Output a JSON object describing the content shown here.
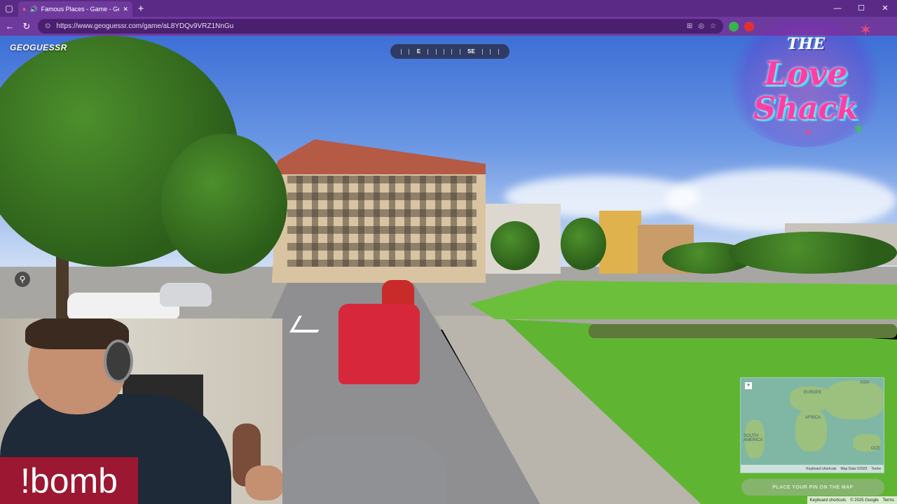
{
  "browser": {
    "tab_title": "Famous Places - Game - Geo",
    "url": "https://www.geoguessr.com/game/aL8YDQv9VRZ1NnGu",
    "window_controls": [
      "—",
      "☐",
      "✕"
    ]
  },
  "game": {
    "logo": "GEOGUESSR",
    "compass": {
      "labels": [
        "E",
        "SE"
      ]
    },
    "minimap": {
      "labels": [
        "EUROPE",
        "ASIA",
        "AFRICA",
        "SOUTH AMERICA",
        "OCE"
      ],
      "footer": [
        "Keyboard shortcuts",
        "Map Data ©2025",
        "Terms"
      ],
      "zoom_label": "+"
    },
    "guess_button": "PLACE YOUR PIN ON THE MAP",
    "attribution": [
      "Keyboard shortcuts",
      "© 2025 Google",
      "Terms"
    ]
  },
  "overlay": {
    "brand_lines": [
      "THE",
      "Love",
      "Shack"
    ],
    "chat_command": "!bomb",
    "colors": {
      "brand_pink": "#ff3ea5",
      "brand_cyan": "#29d4f0",
      "command_bg": "#9b1732",
      "browser_accent": "#6f3a9e"
    }
  }
}
